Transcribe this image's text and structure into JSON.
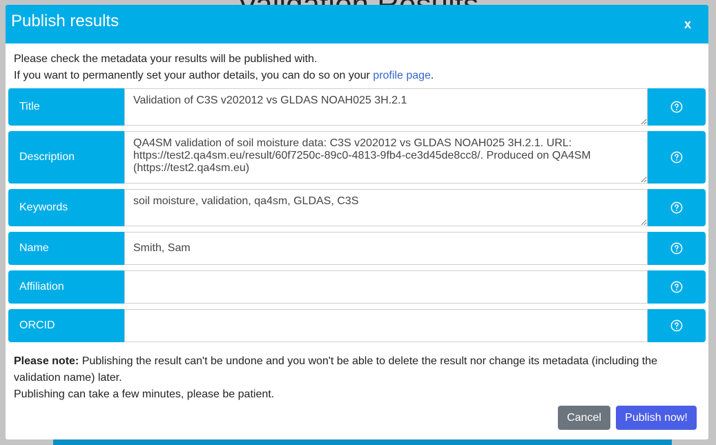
{
  "background": {
    "page_title": "Validation Results"
  },
  "modal": {
    "title": "Publish results",
    "close_label": "x",
    "intro_line1": "Please check the metadata your results will be published with.",
    "intro_line2_prefix": "If you want to permanently set your author details, you can do so on your ",
    "intro_link": "profile page",
    "intro_line2_suffix": ".",
    "fields": {
      "title": {
        "label": "Title",
        "value": "Validation of C3S v202012 vs GLDAS NOAH025 3H.2.1"
      },
      "description": {
        "label": "Description",
        "value": "QA4SM validation of soil moisture data: C3S v202012 vs GLDAS NOAH025 3H.2.1. URL: https://test2.qa4sm.eu/result/60f7250c-89c0-4813-9fb4-ce3d45de8cc8/. Produced on QA4SM (https://test2.qa4sm.eu)"
      },
      "keywords": {
        "label": "Keywords",
        "value": "soil moisture, validation, qa4sm, GLDAS, C3S"
      },
      "name": {
        "label": "Name",
        "value": "Smith, Sam"
      },
      "affiliation": {
        "label": "Affiliation",
        "value": ""
      },
      "orcid": {
        "label": "ORCID",
        "value": ""
      }
    },
    "note_bold": "Please note:",
    "note_text": " Publishing the result can't be undone and you won't be able to delete the result nor change its metadata (including the validation name) later.",
    "note_line2": "Publishing can take a few minutes, please be patient.",
    "cancel_label": "Cancel",
    "publish_label": "Publish now!"
  },
  "colors": {
    "header": "#00ade7",
    "cancel": "#6c757d",
    "publish": "#4a5ee6",
    "link": "#3366cc"
  },
  "icons": {
    "help": "question-circle-icon"
  }
}
